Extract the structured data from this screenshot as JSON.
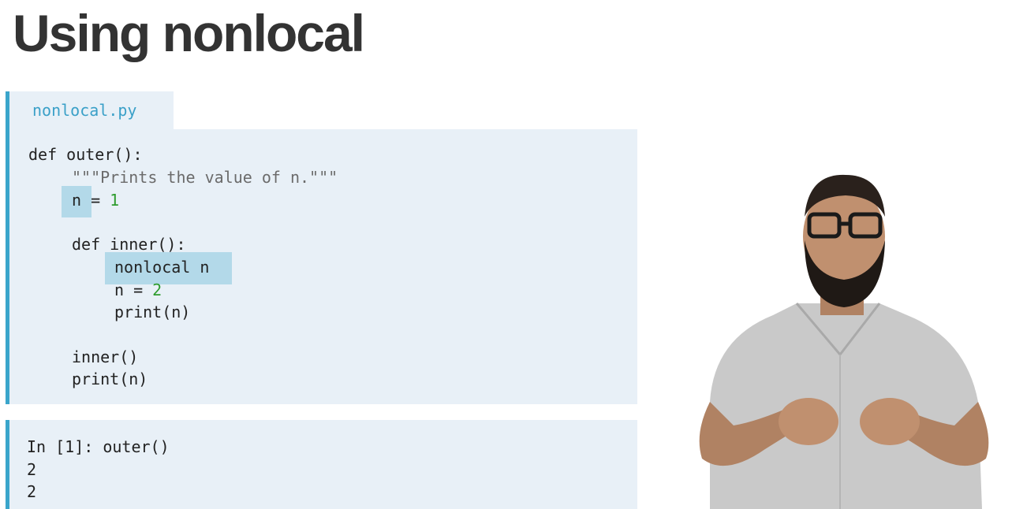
{
  "slide": {
    "title": "Using nonlocal"
  },
  "code_tab": {
    "filename": "nonlocal.py"
  },
  "code": {
    "line1": "def outer():",
    "line2_docstring": "\"\"\"Prints the value of n.\"\"\"",
    "line3_var": "n",
    "line3_op": " = ",
    "line3_num": "1",
    "line5": "def inner():",
    "line6": "nonlocal n",
    "line7_var": "n = ",
    "line7_num": "2",
    "line8": "print(n)",
    "line10": "inner()",
    "line11": "print(n)"
  },
  "output": {
    "prompt": "In [1]: outer()",
    "line1": "2",
    "line2": "2"
  },
  "colors": {
    "accent": "#3aa5cb",
    "panel_bg": "#e8f0f7",
    "highlight": "#b3d9e9",
    "number": "#2e9c2e",
    "docstring": "#6b6b6b"
  },
  "presenter": {
    "icon": "presenter-video"
  }
}
